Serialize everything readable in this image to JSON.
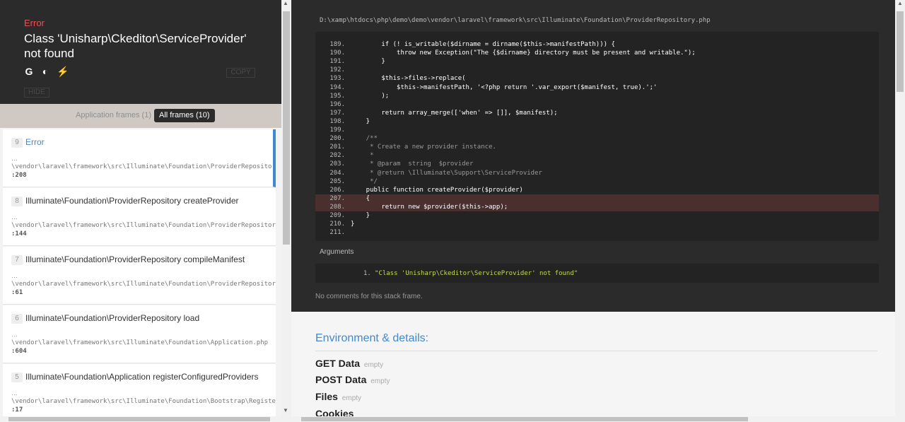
{
  "exception": {
    "type": "Error",
    "message": "Class 'Unisharp\\Ckeditor\\ServiceProvider' not found",
    "icons": [
      "google-icon",
      "duckduckgo-icon",
      "stackoverflow-icon"
    ],
    "icon_glyphs": [
      "G",
      "◐",
      "⚡"
    ],
    "copy_label": "COPY",
    "hide_label": "HIDE"
  },
  "filters": {
    "app_frames": "Application frames (1)",
    "all_frames": "All frames (10)"
  },
  "frames": [
    {
      "index": "9",
      "class": "Error",
      "ellipsis": "…",
      "file": "\\vendor\\laravel\\framework\\src\\Illuminate\\Foundation\\ProviderRepository.php",
      "line": ":208"
    },
    {
      "index": "8",
      "class": "Illuminate\\Foundation\\ProviderRepository createProvider",
      "ellipsis": "…",
      "file": "\\vendor\\laravel\\framework\\src\\Illuminate\\Foundation\\ProviderRepository.php",
      "line": ":144"
    },
    {
      "index": "7",
      "class": "Illuminate\\Foundation\\ProviderRepository compileManifest",
      "ellipsis": "…",
      "file": "\\vendor\\laravel\\framework\\src\\Illuminate\\Foundation\\ProviderRepository.php",
      "line": ":61"
    },
    {
      "index": "6",
      "class": "Illuminate\\Foundation\\ProviderRepository load",
      "ellipsis": "…",
      "file": "\\vendor\\laravel\\framework\\src\\Illuminate\\Foundation\\Application.php",
      "line": ":604"
    },
    {
      "index": "5",
      "class": "Illuminate\\Foundation\\Application registerConfiguredProviders",
      "ellipsis": "…",
      "file": "\\vendor\\laravel\\framework\\src\\Illuminate\\Foundation\\Bootstrap\\RegisterProviders.php",
      "line": ":17"
    }
  ],
  "code": {
    "file_path": "D:\\xamp\\htdocs\\php\\demo\\demo\\vendor\\laravel\\framework\\src\\Illuminate\\Foundation\\ProviderRepository.php",
    "lines": [
      {
        "n": "189.",
        "t": "        if (! is_writable($dirname = dirname($this->manifestPath))) {"
      },
      {
        "n": "190.",
        "t": "            throw new Exception(\"The {$dirname} directory must be present and writable.\");"
      },
      {
        "n": "191.",
        "t": "        }"
      },
      {
        "n": "192.",
        "t": ""
      },
      {
        "n": "193.",
        "t": "        $this->files->replace("
      },
      {
        "n": "194.",
        "t": "            $this->manifestPath, '<?php return '.var_export($manifest, true).';'"
      },
      {
        "n": "195.",
        "t": "        );"
      },
      {
        "n": "196.",
        "t": ""
      },
      {
        "n": "197.",
        "t": "        return array_merge(['when' => []], $manifest);"
      },
      {
        "n": "198.",
        "t": "    }"
      },
      {
        "n": "199.",
        "t": ""
      },
      {
        "n": "200.",
        "t": "    /**"
      },
      {
        "n": "201.",
        "t": "     * Create a new provider instance."
      },
      {
        "n": "202.",
        "t": "     *"
      },
      {
        "n": "203.",
        "t": "     * @param  string  $provider"
      },
      {
        "n": "204.",
        "t": "     * @return \\Illuminate\\Support\\ServiceProvider"
      },
      {
        "n": "205.",
        "t": "     */"
      },
      {
        "n": "206.",
        "t": "    public function createProvider($provider)"
      },
      {
        "n": "207.",
        "t": "    {"
      },
      {
        "n": "208.",
        "t": "        return new $provider($this->app);"
      },
      {
        "n": "209.",
        "t": "    }"
      },
      {
        "n": "210.",
        "t": "}"
      },
      {
        "n": "211.",
        "t": ""
      }
    ],
    "highlighted": [
      "207.",
      "208."
    ]
  },
  "arguments": {
    "title": "Arguments",
    "items": [
      {
        "num": "1.",
        "value": "\"Class 'Unisharp\\Ckeditor\\ServiceProvider' not found\""
      }
    ]
  },
  "no_comments": "No comments for this stack frame.",
  "details": {
    "title": "Environment & details:",
    "rows": [
      {
        "label": "GET Data",
        "state": "empty"
      },
      {
        "label": "POST Data",
        "state": "empty"
      },
      {
        "label": "Files",
        "state": "empty"
      },
      {
        "label": "Cookies",
        "state": ""
      }
    ]
  },
  "colors": {
    "accent": "#4288ce",
    "error": "#e95353",
    "string": "#c6d950",
    "panel": "#2b2b2b"
  }
}
